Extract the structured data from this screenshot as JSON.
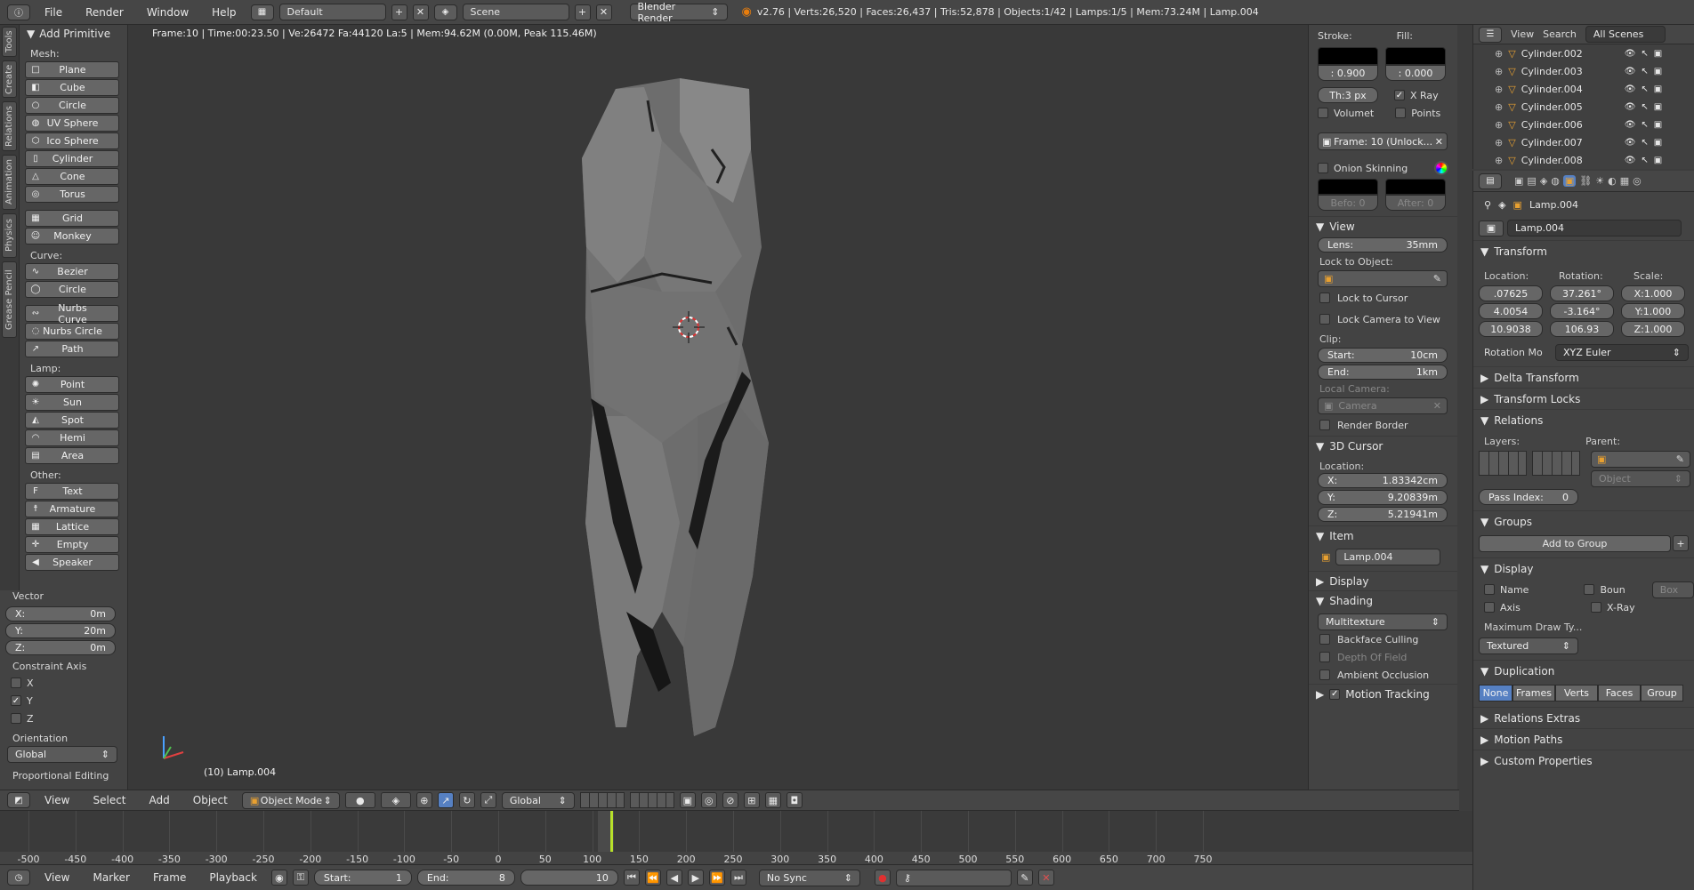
{
  "topbar": {
    "menus": [
      "File",
      "Render",
      "Window",
      "Help"
    ],
    "layout": "Default",
    "scene": "Scene",
    "engine": "Blender Render",
    "stats": "v2.76 | Verts:26,520 | Faces:26,437 | Tris:52,878 | Objects:1/42 | Lamps:1/5 | Mem:73.24M | Lamp.004"
  },
  "lefttabs": [
    "Tools",
    "Create",
    "Relations",
    "Animation",
    "Physics",
    "Grease Pencil"
  ],
  "toolshelf": {
    "title": "Add Primitive",
    "mesh_label": "Mesh:",
    "mesh": [
      {
        "icon": "plane-icon",
        "label": "Plane"
      },
      {
        "icon": "cube-icon",
        "label": "Cube"
      },
      {
        "icon": "circle-icon",
        "label": "Circle"
      },
      {
        "icon": "uv-sphere-icon",
        "label": "UV Sphere"
      },
      {
        "icon": "ico-sphere-icon",
        "label": "Ico Sphere"
      },
      {
        "icon": "cylinder-icon",
        "label": "Cylinder"
      },
      {
        "icon": "cone-icon",
        "label": "Cone"
      },
      {
        "icon": "torus-icon",
        "label": "Torus"
      }
    ],
    "mesh2": [
      {
        "icon": "grid-icon",
        "label": "Grid"
      },
      {
        "icon": "monkey-icon",
        "label": "Monkey"
      }
    ],
    "curve_label": "Curve:",
    "curve": [
      {
        "icon": "bezier-icon",
        "label": "Bezier"
      },
      {
        "icon": "circle-curve-icon",
        "label": "Circle"
      }
    ],
    "curve2": [
      {
        "icon": "nurbs-curve-icon",
        "label": "Nurbs Curve"
      },
      {
        "icon": "nurbs-circle-icon",
        "label": "Nurbs Circle"
      },
      {
        "icon": "path-icon",
        "label": "Path"
      }
    ],
    "lamp_label": "Lamp:",
    "lamp": [
      {
        "icon": "point-lamp-icon",
        "label": "Point"
      },
      {
        "icon": "sun-lamp-icon",
        "label": "Sun"
      },
      {
        "icon": "spot-lamp-icon",
        "label": "Spot"
      },
      {
        "icon": "hemi-lamp-icon",
        "label": "Hemi"
      },
      {
        "icon": "area-lamp-icon",
        "label": "Area"
      }
    ],
    "other_label": "Other:",
    "other": [
      {
        "icon": "text-icon",
        "label": "Text"
      },
      {
        "icon": "armature-icon",
        "label": "Armature"
      },
      {
        "icon": "lattice-icon",
        "label": "Lattice"
      },
      {
        "icon": "empty-icon",
        "label": "Empty"
      },
      {
        "icon": "speaker-icon",
        "label": "Speaker"
      }
    ],
    "vector_label": "Vector",
    "vector": [
      {
        "axis": "X:",
        "value": "0m"
      },
      {
        "axis": "Y:",
        "value": "20m"
      },
      {
        "axis": "Z:",
        "value": "0m"
      }
    ],
    "constraint_label": "Constraint Axis",
    "constraint": [
      {
        "label": "X",
        "checked": false
      },
      {
        "label": "Y",
        "checked": true
      },
      {
        "label": "Z",
        "checked": false
      }
    ],
    "orientation_label": "Orientation",
    "orientation_value": "Global",
    "proportional_label": "Proportional Editing"
  },
  "viewport": {
    "info": "Frame:10 | Time:00:23.50 | Ve:26472 Fa:44120 La:5 | Mem:94.62M (0.00M, Peak 115.46M)",
    "selection": "(10) Lamp.004"
  },
  "npanel": {
    "stroke_label": "Stroke:",
    "fill_label": "Fill:",
    "stroke_value": ": 0.900",
    "fill_value": ": 0.000",
    "thickness": "Th:3 px",
    "xray_label": "X Ray",
    "volumet_label": "Volumet",
    "points_label": "Points",
    "frame_field": "Frame: 10 (Unlock...",
    "onion_label": "Onion Skinning",
    "before": "Befo: 0",
    "after": "After: 0",
    "view_title": "View",
    "lens_label": "Lens:",
    "lens_value": "35mm",
    "lock_obj_label": "Lock to Object:",
    "lock_cursor": "Lock to Cursor",
    "lock_camera": "Lock Camera to View",
    "clip_label": "Clip:",
    "clip_start_label": "Start:",
    "clip_start": "10cm",
    "clip_end_label": "End:",
    "clip_end": "1km",
    "local_camera": "Local Camera:",
    "camera": "Camera",
    "render_border": "Render Border",
    "cursor_title": "3D Cursor",
    "location_label": "Location:",
    "cursor": [
      {
        "axis": "X:",
        "value": "1.83342cm"
      },
      {
        "axis": "Y:",
        "value": "9.20839m"
      },
      {
        "axis": "Z:",
        "value": "5.21941m"
      }
    ],
    "item_title": "Item",
    "item_name": "Lamp.004",
    "display_title": "Display",
    "shading_title": "Shading",
    "shading_mode": "Multitexture",
    "backface": "Backface Culling",
    "dof": "Depth Of Field",
    "ao": "Ambient Occlusion",
    "motion": "Motion Tracking"
  },
  "outliner": {
    "menus": [
      "View",
      "Search"
    ],
    "filter": "All Scenes",
    "items": [
      "Cylinder.002",
      "Cylinder.003",
      "Cylinder.004",
      "Cylinder.005",
      "Cylinder.006",
      "Cylinder.007",
      "Cylinder.008"
    ]
  },
  "props": {
    "breadcrumb": "Lamp.004",
    "name": "Lamp.004",
    "transform": "Transform",
    "location_label": "Location:",
    "rotation_label": "Rotation:",
    "scale_label": "Scale:",
    "location": [
      ".07625",
      "4.0054",
      "10.9038"
    ],
    "rotation": [
      "37.261°",
      "-3.164°",
      "106.93"
    ],
    "scale": [
      "X:1.000",
      "Y:1.000",
      "Z:1.000"
    ],
    "rotation_mode_label": "Rotation Mo",
    "rotation_mode": "XYZ Euler",
    "delta": "Delta Transform",
    "locks": "Transform Locks",
    "relations": "Relations",
    "layers_label": "Layers:",
    "parent_label": "Parent:",
    "parent_type": "Object",
    "pass_index_label": "Pass Index:",
    "pass_index": "0",
    "groups": "Groups",
    "add_group": "Add to Group",
    "display": "Display",
    "disp_name": "Name",
    "disp_bounds": "Boun",
    "disp_box": "Box",
    "disp_axis": "Axis",
    "disp_xray": "X-Ray",
    "max_draw_label": "Maximum Draw Ty...",
    "max_draw": "Textured",
    "duplication": "Duplication",
    "dup_tabs": [
      "None",
      "Frames",
      "Verts",
      "Faces",
      "Group"
    ],
    "rel_extras": "Relations Extras",
    "motion_paths": "Motion Paths",
    "custom_props": "Custom Properties"
  },
  "vpheader": {
    "menus": [
      "View",
      "Select",
      "Add",
      "Object"
    ],
    "mode": "Object Mode",
    "orientation": "Global"
  },
  "timeline": {
    "ticks": [
      "-500",
      "-450",
      "-400",
      "-350",
      "-300",
      "-250",
      "-200",
      "-150",
      "-100",
      "-50",
      "0",
      "50",
      "100",
      "150",
      "200",
      "250",
      "300",
      "350",
      "400",
      "450",
      "500",
      "550",
      "600",
      "650",
      "700",
      "750"
    ],
    "current_frame": 10,
    "menus": [
      "View",
      "Marker",
      "Frame",
      "Playback"
    ],
    "start_label": "Start:",
    "start": "1",
    "end_label": "End:",
    "end": "8",
    "frame": "10",
    "sync": "No Sync"
  },
  "colors": {
    "accent": "#5680c2",
    "keyframe": "#b7e02a",
    "active_tab": "#5680c2"
  }
}
